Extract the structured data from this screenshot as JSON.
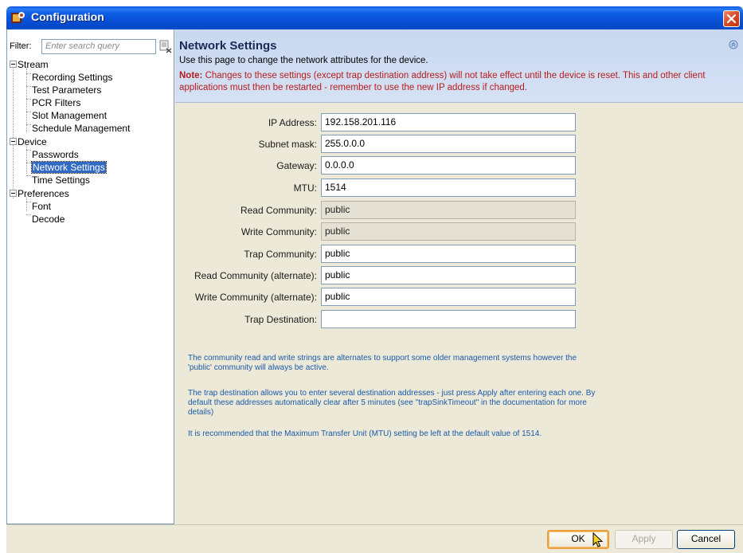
{
  "window": {
    "title": "Configuration"
  },
  "filter": {
    "label": "Filter:",
    "placeholder": "Enter search query"
  },
  "tree": {
    "groups": [
      {
        "label": "Stream",
        "children": [
          "Recording Settings",
          "Test Parameters",
          "PCR Filters",
          "Slot Management",
          "Schedule Management"
        ]
      },
      {
        "label": "Device",
        "children": [
          "Passwords",
          "Network Settings",
          "Time Settings"
        ]
      },
      {
        "label": "Preferences",
        "children": [
          "Font",
          "Decode"
        ]
      }
    ],
    "selected": "Network Settings"
  },
  "header": {
    "title": "Network Settings",
    "description": "Use this page to change the network attributes for the device.",
    "note_prefix": "Note:",
    "note_text": " Changes to these settings (except trap destination address) will not take effect until the device is reset. This and other client applications must then be restarted - remember to use the new IP address if changed."
  },
  "form": {
    "fields": [
      {
        "label": "IP Address:",
        "value": "192.158.201.116",
        "enabled": true
      },
      {
        "label": "Subnet mask:",
        "value": "255.0.0.0",
        "enabled": true
      },
      {
        "label": "Gateway:",
        "value": "0.0.0.0",
        "enabled": true
      },
      {
        "label": "MTU:",
        "value": "1514",
        "enabled": true
      },
      {
        "label": "Read Community:",
        "value": "public",
        "enabled": false
      },
      {
        "label": "Write Community:",
        "value": "public",
        "enabled": false
      },
      {
        "label": "Trap Community:",
        "value": "public",
        "enabled": true
      },
      {
        "label": "Read Community (alternate):",
        "value": "public",
        "enabled": true
      },
      {
        "label": "Write Community (alternate):",
        "value": "public",
        "enabled": true
      },
      {
        "label": "Trap Destination:",
        "value": "",
        "enabled": true
      }
    ]
  },
  "info": {
    "p1": "The community read and write strings are alternates to support some older management systems however the 'public' community will always be active.",
    "p2": "The trap destination allows you to enter several destination addresses - just press Apply after entering each one. By default these addresses automatically clear after 5 minutes (see \"trapSinkTimeout\" in the documentation for more details)",
    "p3": "It is recommended that the Maximum Transfer Unit (MTU) setting be left at the default value of 1514."
  },
  "buttons": {
    "ok": "OK",
    "apply": "Apply",
    "cancel": "Cancel"
  },
  "colors": {
    "titlebar": "#0a56e0",
    "header_band": "#c9d8f0",
    "note": "#b81c1c",
    "info": "#1a5aa8",
    "selection": "#316ac5"
  }
}
